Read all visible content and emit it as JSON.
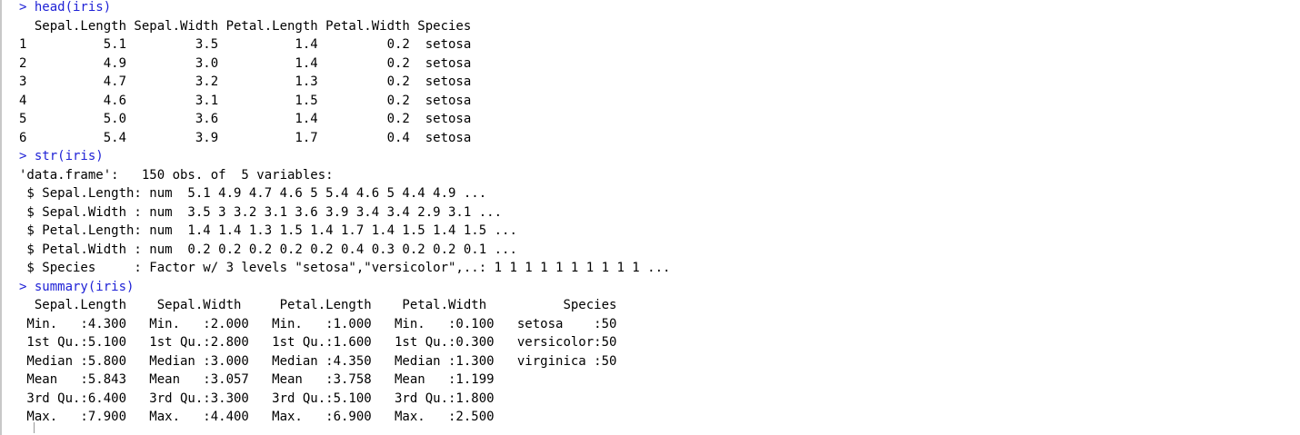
{
  "colors": {
    "command": "#1f22d6",
    "output": "#000000"
  },
  "console": {
    "lines": [
      {
        "type": "command",
        "text": "> head(iris)"
      },
      {
        "type": "output",
        "text": "  Sepal.Length Sepal.Width Petal.Length Petal.Width Species"
      },
      {
        "type": "output",
        "text": "1          5.1         3.5          1.4         0.2  setosa"
      },
      {
        "type": "output",
        "text": "2          4.9         3.0          1.4         0.2  setosa"
      },
      {
        "type": "output",
        "text": "3          4.7         3.2          1.3         0.2  setosa"
      },
      {
        "type": "output",
        "text": "4          4.6         3.1          1.5         0.2  setosa"
      },
      {
        "type": "output",
        "text": "5          5.0         3.6          1.4         0.2  setosa"
      },
      {
        "type": "output",
        "text": "6          5.4         3.9          1.7         0.4  setosa"
      },
      {
        "type": "command",
        "text": "> str(iris)"
      },
      {
        "type": "output",
        "text": "'data.frame':\t150 obs. of  5 variables:"
      },
      {
        "type": "output",
        "text": " $ Sepal.Length: num  5.1 4.9 4.7 4.6 5 5.4 4.6 5 4.4 4.9 ..."
      },
      {
        "type": "output",
        "text": " $ Sepal.Width : num  3.5 3 3.2 3.1 3.6 3.9 3.4 3.4 2.9 3.1 ..."
      },
      {
        "type": "output",
        "text": " $ Petal.Length: num  1.4 1.4 1.3 1.5 1.4 1.7 1.4 1.5 1.4 1.5 ..."
      },
      {
        "type": "output",
        "text": " $ Petal.Width : num  0.2 0.2 0.2 0.2 0.2 0.4 0.3 0.2 0.2 0.1 ..."
      },
      {
        "type": "output",
        "text": " $ Species     : Factor w/ 3 levels \"setosa\",\"versicolor\",..: 1 1 1 1 1 1 1 1 1 1 ..."
      },
      {
        "type": "command",
        "text": "> summary(iris)"
      },
      {
        "type": "output",
        "text": "  Sepal.Length    Sepal.Width     Petal.Length    Petal.Width          Species  "
      },
      {
        "type": "output",
        "text": " Min.   :4.300   Min.   :2.000   Min.   :1.000   Min.   :0.100   setosa    :50  "
      },
      {
        "type": "output",
        "text": " 1st Qu.:5.100   1st Qu.:2.800   1st Qu.:1.600   1st Qu.:0.300   versicolor:50  "
      },
      {
        "type": "output",
        "text": " Median :5.800   Median :3.000   Median :4.350   Median :1.300   virginica :50  "
      },
      {
        "type": "output",
        "text": " Mean   :5.843   Mean   :3.057   Mean   :3.758   Mean   :1.199                  "
      },
      {
        "type": "output",
        "text": " 3rd Qu.:6.400   3rd Qu.:3.300   3rd Qu.:5.100   3rd Qu.:1.800                  "
      },
      {
        "type": "output",
        "text": " Max.   :7.900   Max.   :4.400   Max.   :6.900   Max.   :2.500                  "
      }
    ]
  }
}
